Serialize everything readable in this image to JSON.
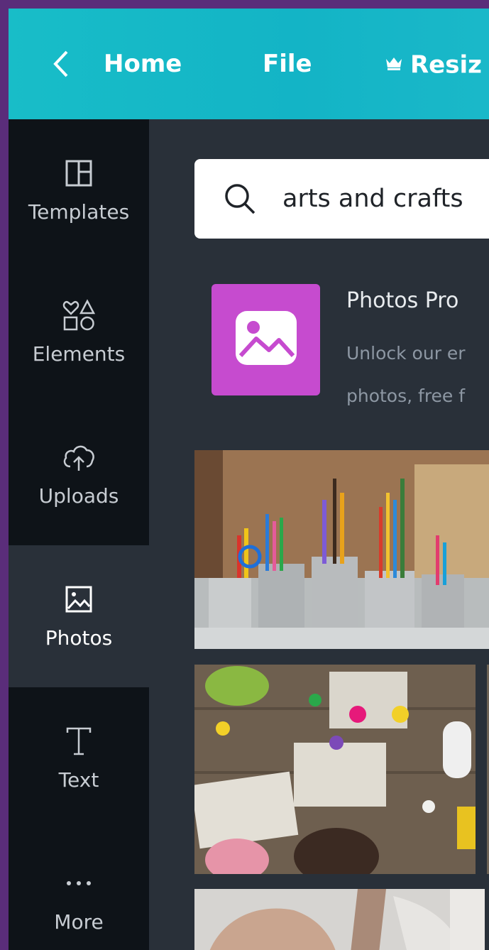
{
  "topbar": {
    "back_icon": "chevron-left-icon",
    "home_label": "Home",
    "file_label": "File",
    "resize_label": "Resiz",
    "resize_icon": "crown-icon",
    "background_color": "#18bdc8"
  },
  "sidebar": {
    "items": [
      {
        "label": "Templates",
        "icon": "templates-icon"
      },
      {
        "label": "Elements",
        "icon": "shapes-icon"
      },
      {
        "label": "Uploads",
        "icon": "cloud-upload-icon"
      },
      {
        "label": "Photos",
        "icon": "image-icon",
        "active": true
      },
      {
        "label": "Text",
        "icon": "text-icon"
      },
      {
        "label": "More",
        "icon": "more-icon"
      }
    ]
  },
  "search": {
    "value": "arts and crafts",
    "icon": "search-icon"
  },
  "promo": {
    "title": "Photos Pro",
    "desc_line1": "Unlock our er",
    "desc_line2": "photos, free f",
    "icon": "image-icon",
    "tile_color": "#c64bcf"
  },
  "photos": [
    {
      "name": "art-supplies-photo"
    },
    {
      "name": "children-painting-photo"
    },
    {
      "name": "hands-clay-photo"
    }
  ],
  "colors": {
    "sidebar_bg": "#0e1318",
    "panel_bg": "#293039",
    "outer_border": "#5a2d7a"
  }
}
